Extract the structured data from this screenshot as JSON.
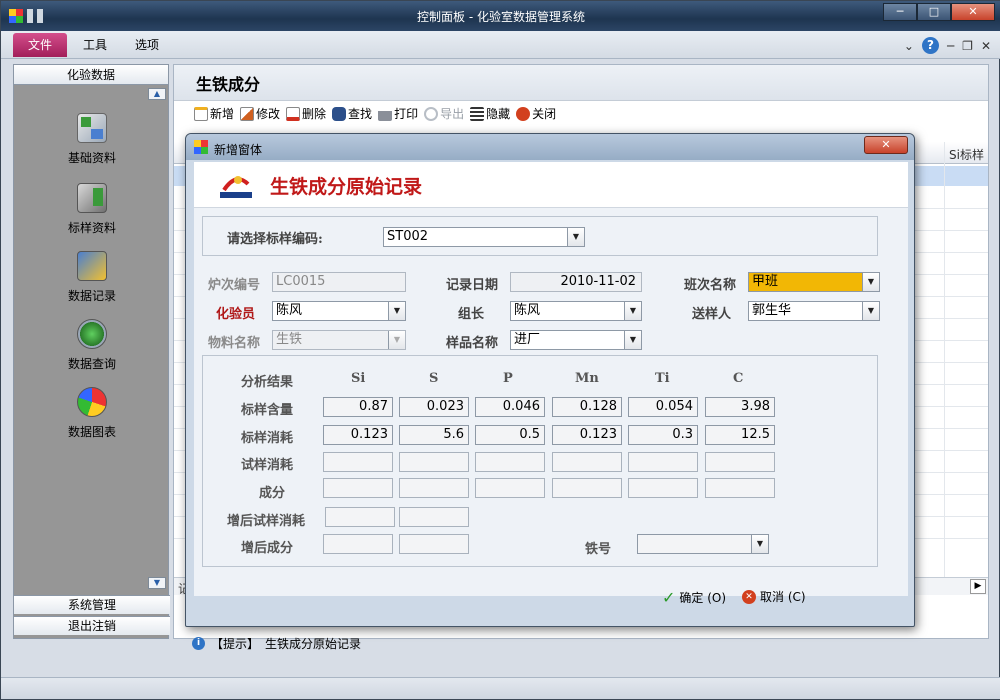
{
  "window": {
    "title": "控制面板 - 化验室数据管理系统"
  },
  "ribbon": {
    "tabs": [
      "文件",
      "工具",
      "选项"
    ]
  },
  "nav": {
    "header": "化验数据",
    "items": [
      "基础资料",
      "标样资料",
      "数据记录",
      "数据查询",
      "数据图表"
    ],
    "bottom": [
      "系统管理",
      "退出注销"
    ]
  },
  "main": {
    "title": "生铁成分",
    "toolbar": [
      "新增",
      "修改",
      "删除",
      "查找",
      "打印",
      "导出",
      "隐藏",
      "关闭"
    ],
    "grid_header_partial": "Si标样",
    "grid_footer_partial": "记",
    "tip_label": "【提示】",
    "tip_text": "生铁成分原始记录"
  },
  "dialog": {
    "title": "新增窗体",
    "heading": "生铁成分原始记录",
    "standard_code_label": "请选择标样编码:",
    "standard_code": "ST002",
    "furnace_label": "炉次编号",
    "furnace_value": "LC0015",
    "date_label": "记录日期",
    "date_value": "2010-11-02",
    "shift_label": "班次名称",
    "shift_value": "甲班",
    "assayer_label": "化验员",
    "assayer_value": "陈风",
    "leader_label": "组长",
    "leader_value": "陈风",
    "sender_label": "送样人",
    "sender_value": "郭生华",
    "material_label": "物料名称",
    "material_value": "生铁",
    "sample_label": "样品名称",
    "sample_value": "进厂",
    "results_label": "分析结果",
    "elements": [
      "Si",
      "S",
      "P",
      "Mn",
      "Ti",
      "C"
    ],
    "rows": {
      "content_label": "标样含量",
      "content": [
        "0.87",
        "0.023",
        "0.046",
        "0.128",
        "0.054",
        "3.98"
      ],
      "consume_label": "标样消耗",
      "consume": [
        "0.123",
        "5.6",
        "0.5",
        "0.123",
        "0.3",
        "12.5"
      ],
      "trial_label": "试样消耗",
      "component_label": "成分",
      "added_trial_label": "增后试样消耗",
      "added_component_label": "增后成分"
    },
    "iron_no_label": "铁号",
    "ok_label": "确定 (O)",
    "cancel_label": "取消 (C)"
  }
}
